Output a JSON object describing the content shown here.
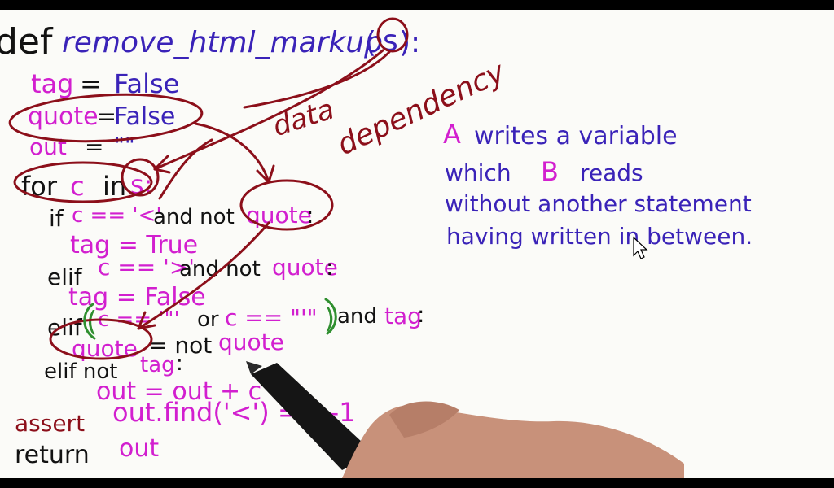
{
  "code": {
    "def_kw": "def",
    "func_name": "remove_html_markup",
    "func_open": "(",
    "param": "s",
    "func_close": "):",
    "l_tag_var": "tag",
    "l_tag_eq": "=",
    "l_tag_val": "False",
    "l_quote_var": "quote",
    "l_quote_eq": "=",
    "l_quote_val": "False",
    "l_out_var": "out",
    "l_out_eq": "=",
    "l_out_val": "\"\"",
    "for_kw": "for",
    "for_var": "c",
    "for_in": "in",
    "for_iter": "s:",
    "if_kw": "if",
    "if_cond1": "c == '<'",
    "if_and": "and not",
    "if_cond2": "quote",
    "if_colon": ":",
    "if_body": "tag = True",
    "elif1_kw": "elif",
    "elif1_cond": "c == '>'",
    "elif1_and": "and not",
    "elif1_var": "quote",
    "elif1_colon": ":",
    "elif1_body": "tag = False",
    "elif2_kw": "elif",
    "elif2_paren": "(",
    "elif2_c1": "c == '\"'",
    "elif2_or": "or",
    "elif2_c2": "c == \"'\"",
    "elif2_paren_close": ")",
    "elif2_and": "and",
    "elif2_tag": "tag",
    "elif2_colon": ":",
    "elif2_body_var": "quote",
    "elif2_body_rest": "= not",
    "elif2_body_val": "quote",
    "elif3_kw": "elif not",
    "elif3_tag": "tag",
    "elif3_colon": ":",
    "elif3_body": "out = out + c",
    "assert_kw": "assert",
    "assert_expr": "out.find('<') == -1",
    "return_kw": "return",
    "return_val": "out"
  },
  "annotations": {
    "data_word": "data",
    "dependency_word": "dependency"
  },
  "definition": {
    "line1_a": "A",
    "line1_rest": "writes a variable",
    "line2_a": "which",
    "line2_b": "B",
    "line2_rest": "reads",
    "line3": "without another statement",
    "line4": "having written in between."
  },
  "colors": {
    "black_ink": "#121212",
    "magenta_ink": "#d21fcf",
    "blue_ink": "#3a23b8",
    "red_ink": "#8c0f1a",
    "green_ink": "#2f8f2f",
    "background": "#fbfbf8"
  }
}
